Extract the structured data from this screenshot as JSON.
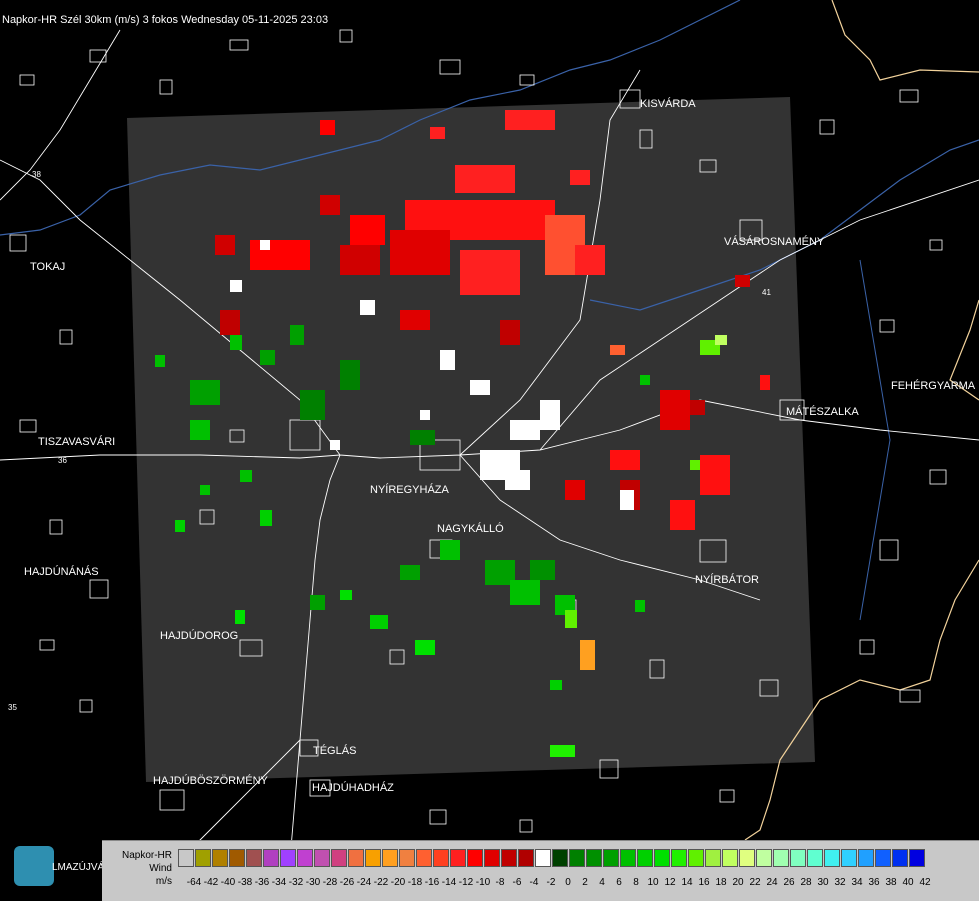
{
  "header": {
    "title": "Napkor-HR Szél 30km (m/s) 3 fokos Wednesday 05-11-2025 23:03"
  },
  "map": {
    "towns": [
      {
        "id": "kisvarda",
        "name": "KISVÁRDA"
      },
      {
        "id": "vasarosnameny",
        "name": "VÁSÁROSNAMÉNY"
      },
      {
        "id": "tokaj",
        "name": "TOKAJ"
      },
      {
        "id": "fehergyarmat",
        "name": "FEHÉRGYARMA"
      },
      {
        "id": "mateszalka",
        "name": "MÁTÉSZALKA"
      },
      {
        "id": "tiszavasvari",
        "name": "TISZAVASVÁRI"
      },
      {
        "id": "nyiregyhaza",
        "name": "NYÍREGYHÁZA"
      },
      {
        "id": "nagykallo",
        "name": "NAGYKÁLLÓ"
      },
      {
        "id": "hajdunanas",
        "name": "HAJDÚNÁNÁS"
      },
      {
        "id": "nyirbator",
        "name": "NYÍRBÁTOR"
      },
      {
        "id": "hajdudorog",
        "name": "HAJDÚDOROG"
      },
      {
        "id": "teglas",
        "name": "TÉGLÁS"
      },
      {
        "id": "hajduboszormeny",
        "name": "HAJDÚBÖSZÖRMÉNY"
      },
      {
        "id": "hajduhadhaz",
        "name": "HAJDÚHADHÁZ"
      }
    ],
    "road_numbers": [
      "41",
      "38",
      "36",
      "35"
    ],
    "colors": {
      "background": "#000000",
      "radar_coverage": "#333333",
      "outline": "#ffffff",
      "rivers": "#3a62a8",
      "border": "#f2d29b"
    }
  },
  "legend": {
    "name_line1": "Napkor-HR",
    "name_line2": "Wind",
    "name_line3": "m/s",
    "swatch_colors": [
      "#c8c8c8",
      "#a0a000",
      "#b08000",
      "#a05a00",
      "#a05050",
      "#b040c0",
      "#a040ff",
      "#c040d0",
      "#c050b0",
      "#d04080",
      "#f07040",
      "#f8a000",
      "#ffa020",
      "#f08040",
      "#ff6030",
      "#ff4020",
      "#ff2020",
      "#ff0000",
      "#e00000",
      "#c00000",
      "#b00000",
      "#ffffff",
      "#004000",
      "#008000",
      "#009000",
      "#00a000",
      "#00c000",
      "#00d000",
      "#00e000",
      "#20f000",
      "#60f000",
      "#a0f040",
      "#c0ff60",
      "#e0ff80",
      "#c0ffa0",
      "#a0ffb0",
      "#80ffc0",
      "#60ffd0",
      "#40f0f0",
      "#30d0ff",
      "#20a0ff",
      "#1060ff",
      "#0030f0",
      "#0000e0"
    ],
    "tick_labels": [
      "-64",
      "-42",
      "-40",
      "-38",
      "-36",
      "-34",
      "-32",
      "-30",
      "-28",
      "-26",
      "-24",
      "-22",
      "-20",
      "-18",
      "-16",
      "-14",
      "-12",
      "-10",
      "-8",
      "-6",
      "-4",
      "-2",
      "0",
      "2",
      "4",
      "6",
      "8",
      "10",
      "12",
      "14",
      "16",
      "18",
      "20",
      "22",
      "24",
      "26",
      "28",
      "30",
      "32",
      "34",
      "36",
      "38",
      "40",
      "42"
    ]
  },
  "logo": {
    "text": "LMAZÚJVÁR"
  }
}
